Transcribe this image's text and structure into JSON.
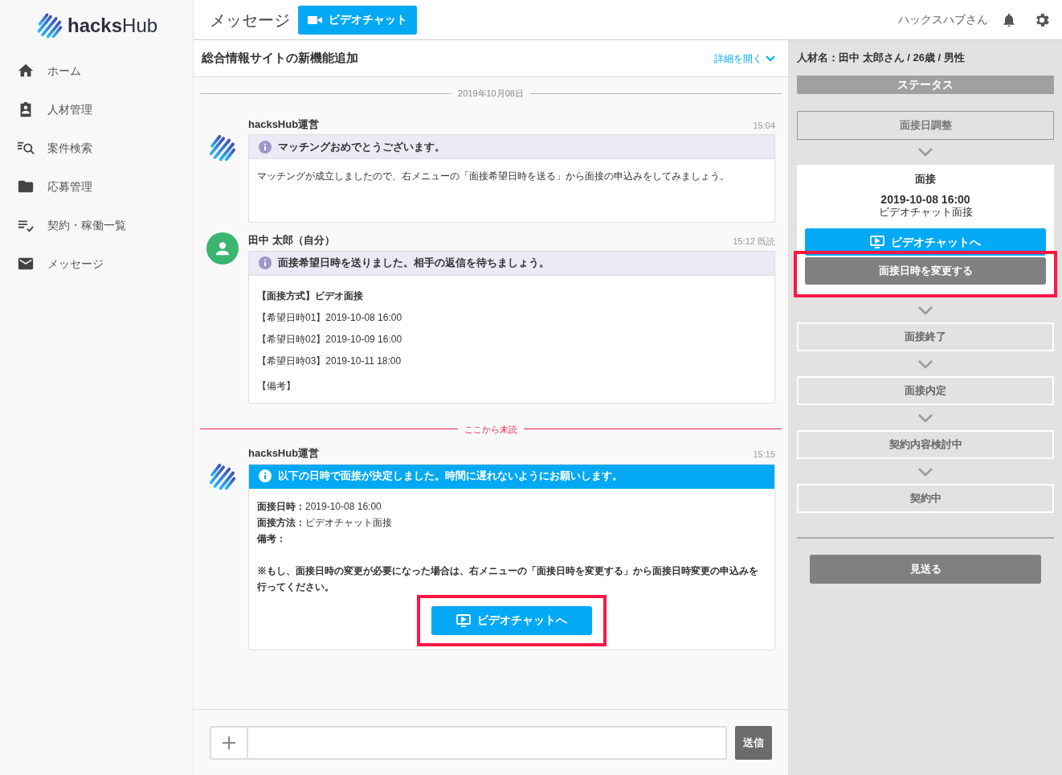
{
  "brand": {
    "name_bold": "hacks",
    "name_light": "Hub"
  },
  "sidebar": {
    "items": [
      {
        "label": "ホーム",
        "kind": "home"
      },
      {
        "label": "人材管理",
        "kind": "badge"
      },
      {
        "label": "案件検索",
        "kind": "search-list"
      },
      {
        "label": "応募管理",
        "kind": "folder"
      },
      {
        "label": "契約・稼働一覧",
        "kind": "checklist"
      },
      {
        "label": "メッセージ",
        "kind": "mail"
      }
    ]
  },
  "header": {
    "title": "メッセージ",
    "video_button": "ビデオチャット",
    "user": "ハックスハブさん"
  },
  "thread": {
    "title": "総合情報サイトの新機能追加",
    "details_link": "詳細を開く",
    "timeline": [
      {
        "kind": "date_divider",
        "text": "2019年10月08日"
      },
      {
        "kind": "system_message",
        "sender": "hacksHub運営",
        "time": "15:04",
        "banner": {
          "text": "マッチングおめでとうございます。",
          "emphasized": false
        },
        "lines": [
          {
            "text": "マッチングが成立しましたので、右メニューの「面接希望日時を送る」から面接の申込みをしてみましょう。",
            "bold": false
          }
        ]
      },
      {
        "kind": "self_message",
        "sender": "田中 太郎（自分）",
        "time": "15:12 既読",
        "banner": {
          "text": "面接希望日時を送りました。相手の返信を待ちましょう。",
          "emphasized": false
        },
        "lines": [
          {
            "text": "【面接方式】ビデオ面接",
            "bold": true
          },
          {
            "text": "【希望日時01】2019-10-08 16:00",
            "bold": false
          },
          {
            "text": "【希望日時02】2019-10-09 16:00",
            "bold": false
          },
          {
            "text": "【希望日時03】2019-10-11 18:00",
            "bold": false
          },
          {
            "text": "【備考】",
            "bold": false
          }
        ]
      },
      {
        "kind": "unread_divider",
        "text": "ここから未読"
      },
      {
        "kind": "system_message",
        "sender": "hacksHub運営",
        "time": "15:15",
        "banner": {
          "text": "以下の日時で面接が決定しました。時間に遅れないようにお願いします。",
          "emphasized": true
        },
        "fields": [
          "**面接日時：**2019-10-08 16:00",
          "**面接方法：**ビデオチャット面接",
          "**備考：**"
        ],
        "note": "※もし、面接日時の変更が必要になった場合は、右メニューの「面接日時を変更する」から面接日時変更の申込みを行ってください。",
        "button": {
          "label": "ビデオチャットへ",
          "highlighted": true
        }
      }
    ]
  },
  "composer": {
    "send_button": "送信"
  },
  "status_panel": {
    "candidate": "人材名：田中 太郎さん / 26歳 / 男性",
    "heading": "ステータス",
    "steps": [
      {
        "kind": "done",
        "label": "面接日調整"
      },
      {
        "kind": "current",
        "label": "面接",
        "datetime": "2019-10-08 16:00",
        "method": "ビデオチャット面接",
        "video_button": "ビデオチャットへ",
        "change_button": {
          "label": "面接日時を変更する",
          "highlighted": true
        }
      },
      {
        "kind": "upcoming",
        "label": "面接終了"
      },
      {
        "kind": "upcoming",
        "label": "面接内定"
      },
      {
        "kind": "upcoming",
        "label": "契約内容検討中"
      },
      {
        "kind": "upcoming",
        "label": "契約中"
      }
    ],
    "decline_button": "見送る"
  }
}
